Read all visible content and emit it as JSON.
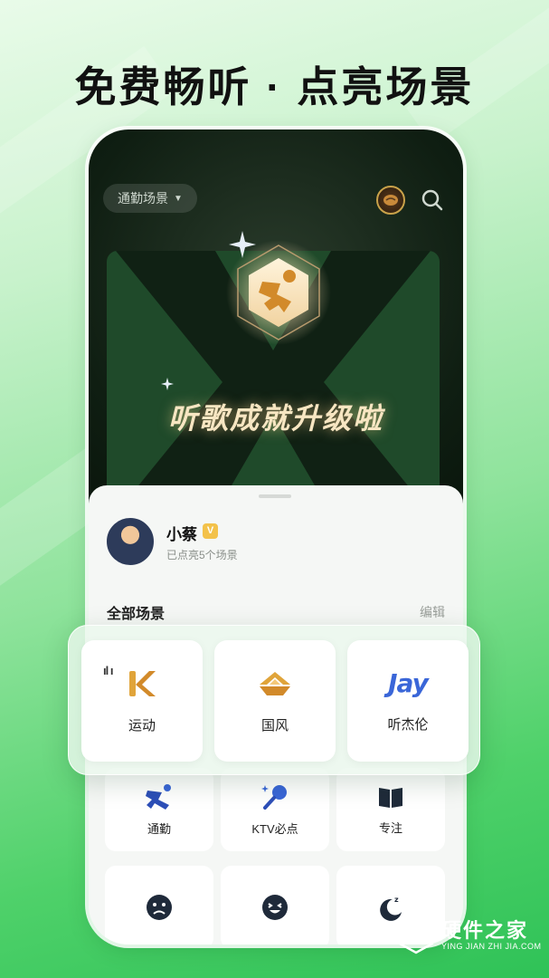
{
  "headline": "免费畅听 · 点亮场景",
  "header": {
    "scene_selector": "通勤场景",
    "bean_icon": "bean-icon",
    "search_icon": "search-icon"
  },
  "achievement": {
    "text": "听歌成就升级啦",
    "badge_icon": "runner-badge-icon"
  },
  "profile": {
    "name": "小蔡",
    "verified": "V",
    "subtitle": "已点亮5个场景"
  },
  "scenes": {
    "title": "全部场景",
    "edit_label": "编辑",
    "featured": [
      {
        "label": "运动",
        "icon": "k-icon"
      },
      {
        "label": "国风",
        "icon": "fan-icon"
      },
      {
        "label": "听杰伦",
        "icon": "jay-icon",
        "logo_text": "Jay"
      }
    ],
    "row2": [
      {
        "label": "通勤",
        "icon": "runner-icon"
      },
      {
        "label": "KTV必点",
        "icon": "microphone-icon"
      },
      {
        "label": "专注",
        "icon": "book-icon"
      }
    ],
    "row3": [
      {
        "label": "",
        "icon": "sad-face-icon"
      },
      {
        "label": "",
        "icon": "laugh-face-icon"
      },
      {
        "label": "",
        "icon": "moon-sleep-icon"
      }
    ]
  },
  "watermark": {
    "main": "硬件之家",
    "sub": "YING JIAN ZHI JIA.COM"
  },
  "colors": {
    "accent_green": "#3ac85e",
    "gold": "#e0a43a",
    "blue": "#3a66d8",
    "dark": "#0f1e12"
  }
}
